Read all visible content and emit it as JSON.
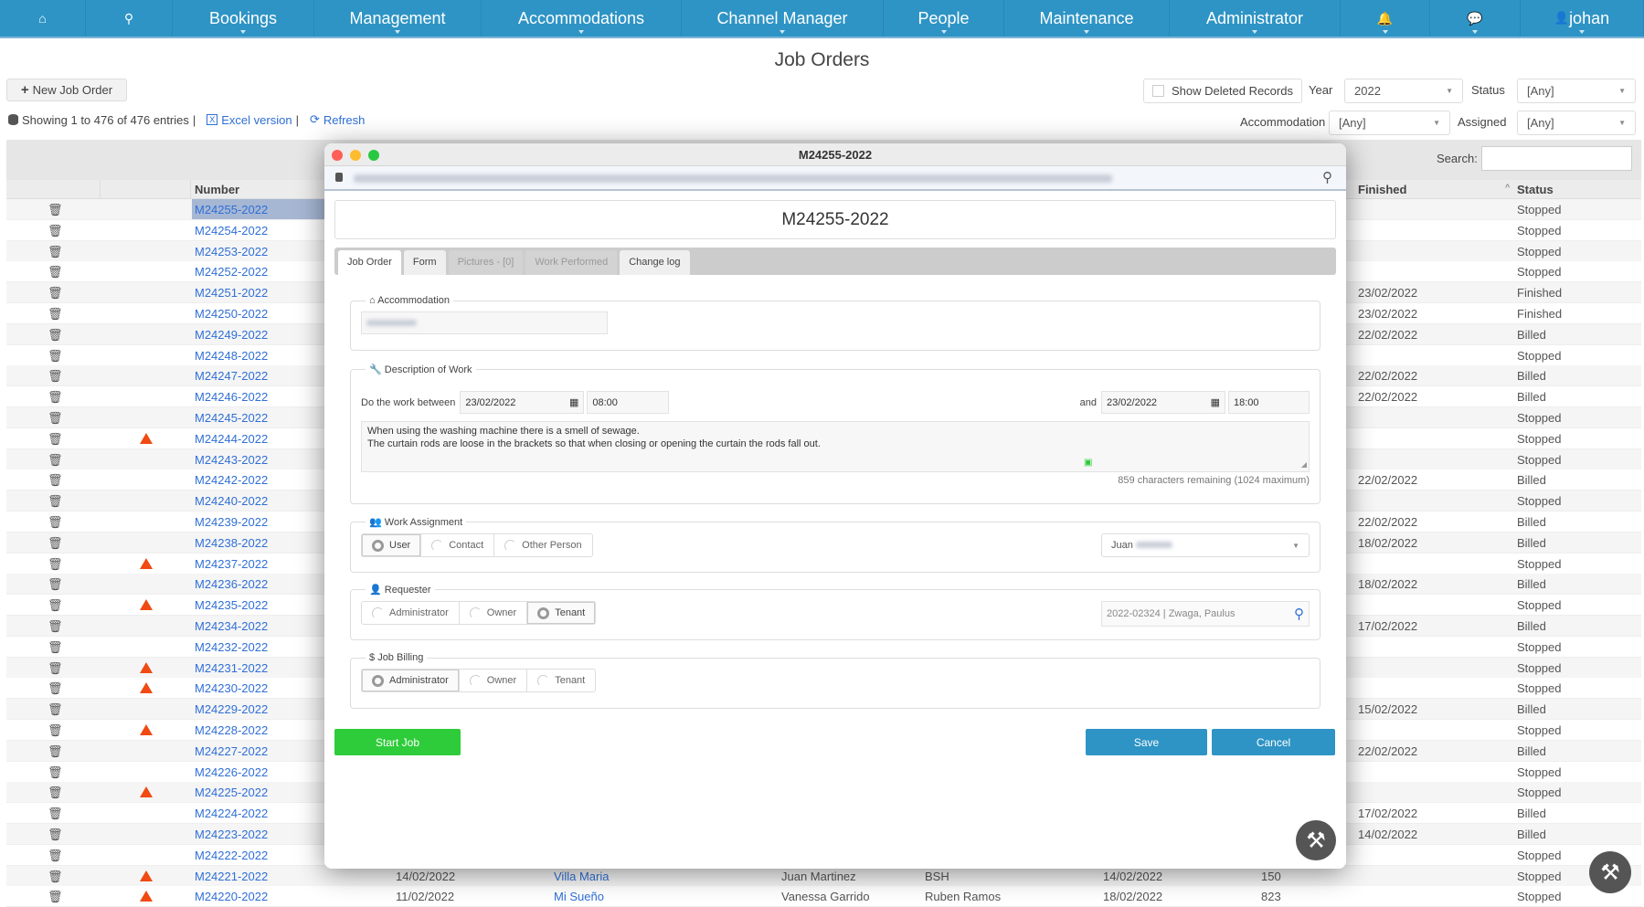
{
  "nav": {
    "items": [
      {
        "label": "",
        "icon": "home-icon",
        "glyph": "⌂"
      },
      {
        "label": "",
        "icon": "search-icon",
        "glyph": "⚲"
      },
      {
        "label": "Bookings"
      },
      {
        "label": "Management"
      },
      {
        "label": "Accommodations"
      },
      {
        "label": "Channel Manager"
      },
      {
        "label": "People"
      },
      {
        "label": "Maintenance"
      },
      {
        "label": "Administrator"
      },
      {
        "label": "",
        "icon": "bell-icon",
        "glyph": "🔔"
      },
      {
        "label": "",
        "icon": "chat-icon",
        "glyph": "💬"
      },
      {
        "label": "johan",
        "icon": "user-icon"
      }
    ]
  },
  "page": {
    "title": "Job Orders",
    "new_button": "New Job Order",
    "showing": "Showing 1 to 476 of 476 entries",
    "excel": "Excel version",
    "refresh": "Refresh"
  },
  "filters": {
    "show_deleted": "Show Deleted Records",
    "year_label": "Year",
    "year_value": "2022",
    "status_label": "Status",
    "status_value": "[Any]",
    "accommodation_label": "Accommodation",
    "accommodation_value": "[Any]",
    "assigned_label": "Assigned",
    "assigned_value": "[Any]",
    "search_label": "Search:"
  },
  "table": {
    "headers": {
      "number": "Number",
      "finished": "Finished",
      "status": "Status"
    },
    "rows": [
      {
        "number": "M24255-2022",
        "status": "Stopped"
      },
      {
        "number": "M24254-2022",
        "status": "Stopped"
      },
      {
        "number": "M24253-2022",
        "status": "Stopped"
      },
      {
        "number": "M24252-2022",
        "status": "Stopped"
      },
      {
        "number": "M24251-2022",
        "finished": "23/02/2022",
        "status": "Finished"
      },
      {
        "number": "M24250-2022",
        "finished": "23/02/2022",
        "status": "Finished"
      },
      {
        "number": "M24249-2022",
        "finished": "22/02/2022",
        "status": "Billed"
      },
      {
        "number": "M24248-2022",
        "status": "Stopped"
      },
      {
        "number": "M24247-2022",
        "finished": "22/02/2022",
        "status": "Billed"
      },
      {
        "number": "M24246-2022",
        "finished": "22/02/2022",
        "status": "Billed"
      },
      {
        "number": "M24245-2022",
        "status": "Stopped"
      },
      {
        "number": "M24244-2022",
        "warning": true,
        "status": "Stopped"
      },
      {
        "number": "M24243-2022",
        "status": "Stopped"
      },
      {
        "number": "M24242-2022",
        "finished": "22/02/2022",
        "status": "Billed"
      },
      {
        "number": "M24240-2022",
        "status": "Stopped"
      },
      {
        "number": "M24239-2022",
        "finished": "22/02/2022",
        "status": "Billed"
      },
      {
        "number": "M24238-2022",
        "finished": "18/02/2022",
        "status": "Billed"
      },
      {
        "number": "M24237-2022",
        "warning": true,
        "status": "Stopped"
      },
      {
        "number": "M24236-2022",
        "finished": "18/02/2022",
        "status": "Billed"
      },
      {
        "number": "M24235-2022",
        "warning": true,
        "status": "Stopped"
      },
      {
        "number": "M24234-2022",
        "finished": "17/02/2022",
        "status": "Billed"
      },
      {
        "number": "M24232-2022",
        "status": "Stopped"
      },
      {
        "number": "M24231-2022",
        "warning": true,
        "status": "Stopped"
      },
      {
        "number": "M24230-2022",
        "warning": true,
        "status": "Stopped"
      },
      {
        "number": "M24229-2022",
        "finished": "15/02/2022",
        "status": "Billed"
      },
      {
        "number": "M24228-2022",
        "warning": true,
        "status": "Stopped"
      },
      {
        "number": "M24227-2022",
        "finished": "22/02/2022",
        "status": "Billed"
      },
      {
        "number": "M24226-2022",
        "status": "Stopped"
      },
      {
        "number": "M24225-2022",
        "warning": true,
        "status": "Stopped"
      },
      {
        "number": "M24224-2022",
        "finished": "17/02/2022",
        "status": "Billed"
      },
      {
        "number": "M24223-2022",
        "finished": "14/02/2022",
        "status": "Billed"
      },
      {
        "number": "M24222-2022",
        "status": "Stopped"
      },
      {
        "number": "M24221-2022",
        "warning": true,
        "date": "14/02/2022",
        "accommodation": "Villa Maria",
        "person": "Juan Martinez",
        "company": "BSH",
        "date2": "14/02/2022",
        "amount": "150",
        "status": "Stopped"
      },
      {
        "number": "M24220-2022",
        "warning": true,
        "date": "11/02/2022",
        "accommodation": "Mi Sueño",
        "person": "Vanessa Garrido",
        "company": "Ruben Ramos",
        "date2": "18/02/2022",
        "amount": "823",
        "status": "Stopped"
      }
    ]
  },
  "modal": {
    "window_title": "M24255-2022",
    "heading": "M24255-2022",
    "tabs": [
      {
        "label": "Job Order",
        "state": "active"
      },
      {
        "label": "Form",
        "state": "enabled"
      },
      {
        "label": "Pictures - [0]",
        "state": "disabled"
      },
      {
        "label": "Work Performed",
        "state": "disabled"
      },
      {
        "label": "Change log",
        "state": "enabled"
      }
    ],
    "accommodation": {
      "legend": "Accommodation"
    },
    "description": {
      "legend": "Description of Work",
      "between_label": "Do the work between",
      "start_date": "23/02/2022",
      "start_time": "08:00",
      "and_label": "and",
      "end_date": "23/02/2022",
      "end_time": "18:00",
      "text": "When using the washing machine there is a smell of sewage.\nThe curtain rods are loose in the brackets so that when closing or opening the curtain the rods fall out.",
      "remaining": "859 characters remaining (1024 maximum)"
    },
    "assignment": {
      "legend": "Work Assignment",
      "options": [
        "User",
        "Contact",
        "Other Person"
      ],
      "selected": "User",
      "assignee": "Juan"
    },
    "requester": {
      "legend": "Requester",
      "options": [
        "Administrator",
        "Owner",
        "Tenant"
      ],
      "selected": "Tenant",
      "value": "2022-02324 | Zwaga, Paulus"
    },
    "billing": {
      "legend": "Job Billing",
      "options": [
        "Administrator",
        "Owner",
        "Tenant"
      ],
      "selected": "Administrator"
    },
    "start_button": "Start Job",
    "save_button": "Save",
    "cancel_button": "Cancel"
  },
  "colors": {
    "nav": "#2e94c5",
    "link": "#2f6fd6",
    "start": "#2ecc3a",
    "save": "#2e94c5",
    "warning": "#f04a12"
  }
}
